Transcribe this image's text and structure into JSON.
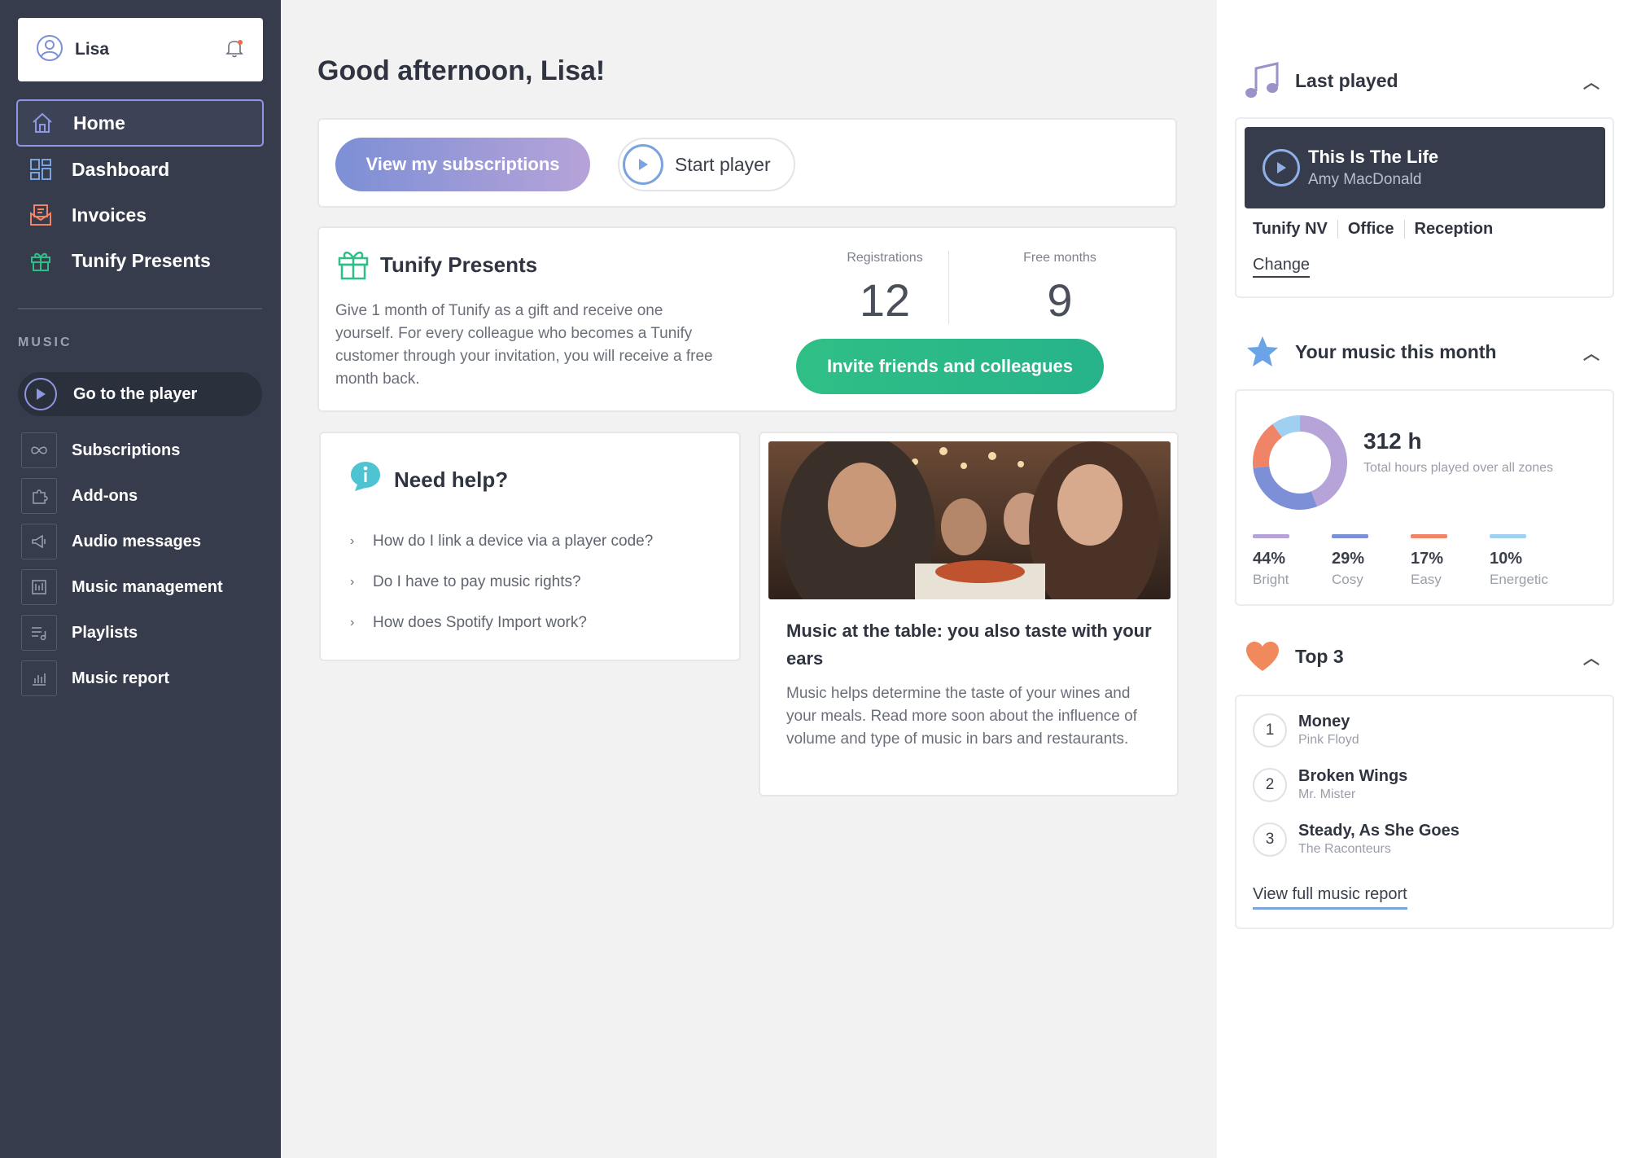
{
  "user": {
    "name": "Lisa"
  },
  "nav": [
    {
      "label": "Home"
    },
    {
      "label": "Dashboard"
    },
    {
      "label": "Invoices"
    },
    {
      "label": "Tunify Presents"
    }
  ],
  "music_section": {
    "label": "MUSIC",
    "player_button": "Go to the player",
    "items": [
      {
        "label": "Subscriptions"
      },
      {
        "label": "Add-ons"
      },
      {
        "label": "Audio messages"
      },
      {
        "label": "Music management"
      },
      {
        "label": "Playlists"
      },
      {
        "label": "Music report"
      }
    ]
  },
  "greeting": "Good afternoon, Lisa!",
  "actions": {
    "subscriptions_label": "View my subscriptions",
    "start_player_label": "Start player"
  },
  "presents": {
    "title": "Tunify Presents",
    "description": "Give 1 month of Tunify as a gift and receive one yourself. For every colleague who becomes a Tunify customer through your invitation, you will receive a free month back.",
    "registrations_label": "Registrations",
    "registrations_value": "12",
    "free_months_label": "Free months",
    "free_months_value": "9",
    "invite_label": "Invite friends and colleagues"
  },
  "help": {
    "title": "Need help?",
    "items": [
      {
        "label": "How do I link a device via a player code?"
      },
      {
        "label": "Do I have to pay music rights?"
      },
      {
        "label": "How does Spotify Import work?"
      }
    ]
  },
  "article": {
    "title": "Music at the table: you also taste with your ears",
    "body": "Music helps determine the taste of your wines and your meals. Read more soon about the influence of volume and type of music in bars and restaurants."
  },
  "last_played": {
    "title": "Last played",
    "song": "This Is The Life",
    "artist": "Amy MacDonald",
    "zones": [
      "Tunify NV",
      "Office",
      "Reception"
    ],
    "change_label": "Change"
  },
  "music_month": {
    "title": "Your music this month",
    "hours": "312 h",
    "hours_label": "Total hours played over all zones",
    "moods": [
      {
        "pct": "44%",
        "name": "Bright",
        "value": 44,
        "color": "#b6a3d8"
      },
      {
        "pct": "29%",
        "name": "Cosy",
        "value": 29,
        "color": "#7d8fd6"
      },
      {
        "pct": "17%",
        "name": "Easy",
        "value": 17,
        "color": "#ef8466"
      },
      {
        "pct": "10%",
        "name": "Energetic",
        "value": 10,
        "color": "#9fd0f2"
      }
    ]
  },
  "top3": {
    "title": "Top 3",
    "items": [
      {
        "rank": "1",
        "title": "Money",
        "artist": "Pink Floyd"
      },
      {
        "rank": "2",
        "title": "Broken Wings",
        "artist": "Mr. Mister"
      },
      {
        "rank": "3",
        "title": "Steady, As She Goes",
        "artist": "The Raconteurs"
      }
    ],
    "report_label": "View full music report"
  }
}
